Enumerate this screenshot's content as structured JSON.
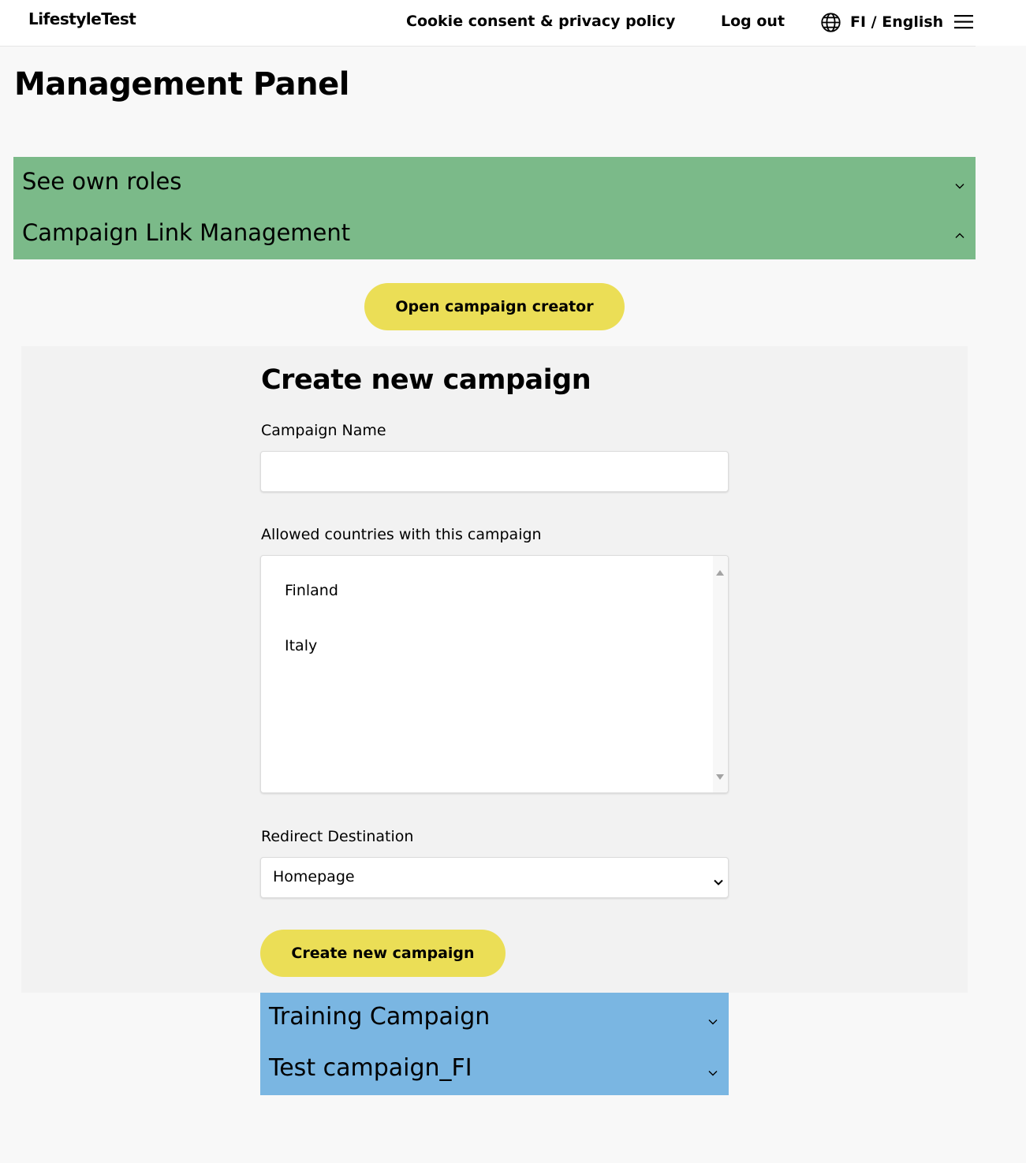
{
  "header": {
    "logo": "LifestyleTest",
    "nav": {
      "cookie": "Cookie consent & privacy policy",
      "logout": "Log out",
      "language": "FI / English"
    },
    "icons": [
      "globe-icon",
      "hamburger-menu-icon"
    ]
  },
  "page": {
    "title": "Management Panel"
  },
  "sections": [
    {
      "label": "See own roles",
      "expanded": false
    },
    {
      "label": "Campaign Link Management",
      "expanded": true
    }
  ],
  "campaign_manager": {
    "open_creator_label": "Open campaign creator",
    "form": {
      "title": "Create new campaign",
      "name_label": "Campaign Name",
      "name_value": "",
      "countries_label": "Allowed countries with this campaign",
      "countries": [
        "Finland",
        "Italy"
      ],
      "redirect_label": "Redirect Destination",
      "redirect_value": "Homepage",
      "submit_label": "Create new campaign"
    },
    "campaigns": [
      {
        "name": "Training Campaign"
      },
      {
        "name": "Test campaign_FI"
      }
    ]
  },
  "colors": {
    "page_bg": "#f8f8f8",
    "green_accordion": "#7bba89",
    "blue_accordion": "#7ab6e2",
    "yellow_button": "#ebde56",
    "creator_panel_bg": "#f2f2f2"
  }
}
